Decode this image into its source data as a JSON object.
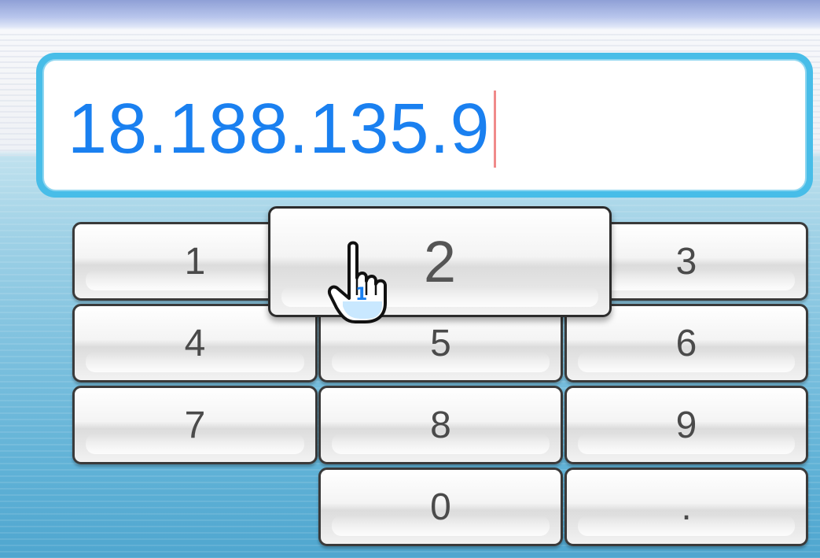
{
  "address_input": {
    "value": "18.188.135.9"
  },
  "keypad": {
    "keys": [
      {
        "label": "1"
      },
      {
        "label": "2"
      },
      {
        "label": "3"
      },
      {
        "label": "4"
      },
      {
        "label": "5"
      },
      {
        "label": "6"
      },
      {
        "label": "7"
      },
      {
        "label": "8"
      },
      {
        "label": "9"
      },
      {
        "label": "0"
      },
      {
        "label": "."
      }
    ],
    "pressed_key": "2"
  },
  "pointer": {
    "icon": "hand-pointer-icon",
    "player_number": "1"
  },
  "colors": {
    "input_text": "#1a80f0",
    "input_border": "#48bde8",
    "caret": "#f08a8a",
    "key_text": "#4a4a4a"
  }
}
